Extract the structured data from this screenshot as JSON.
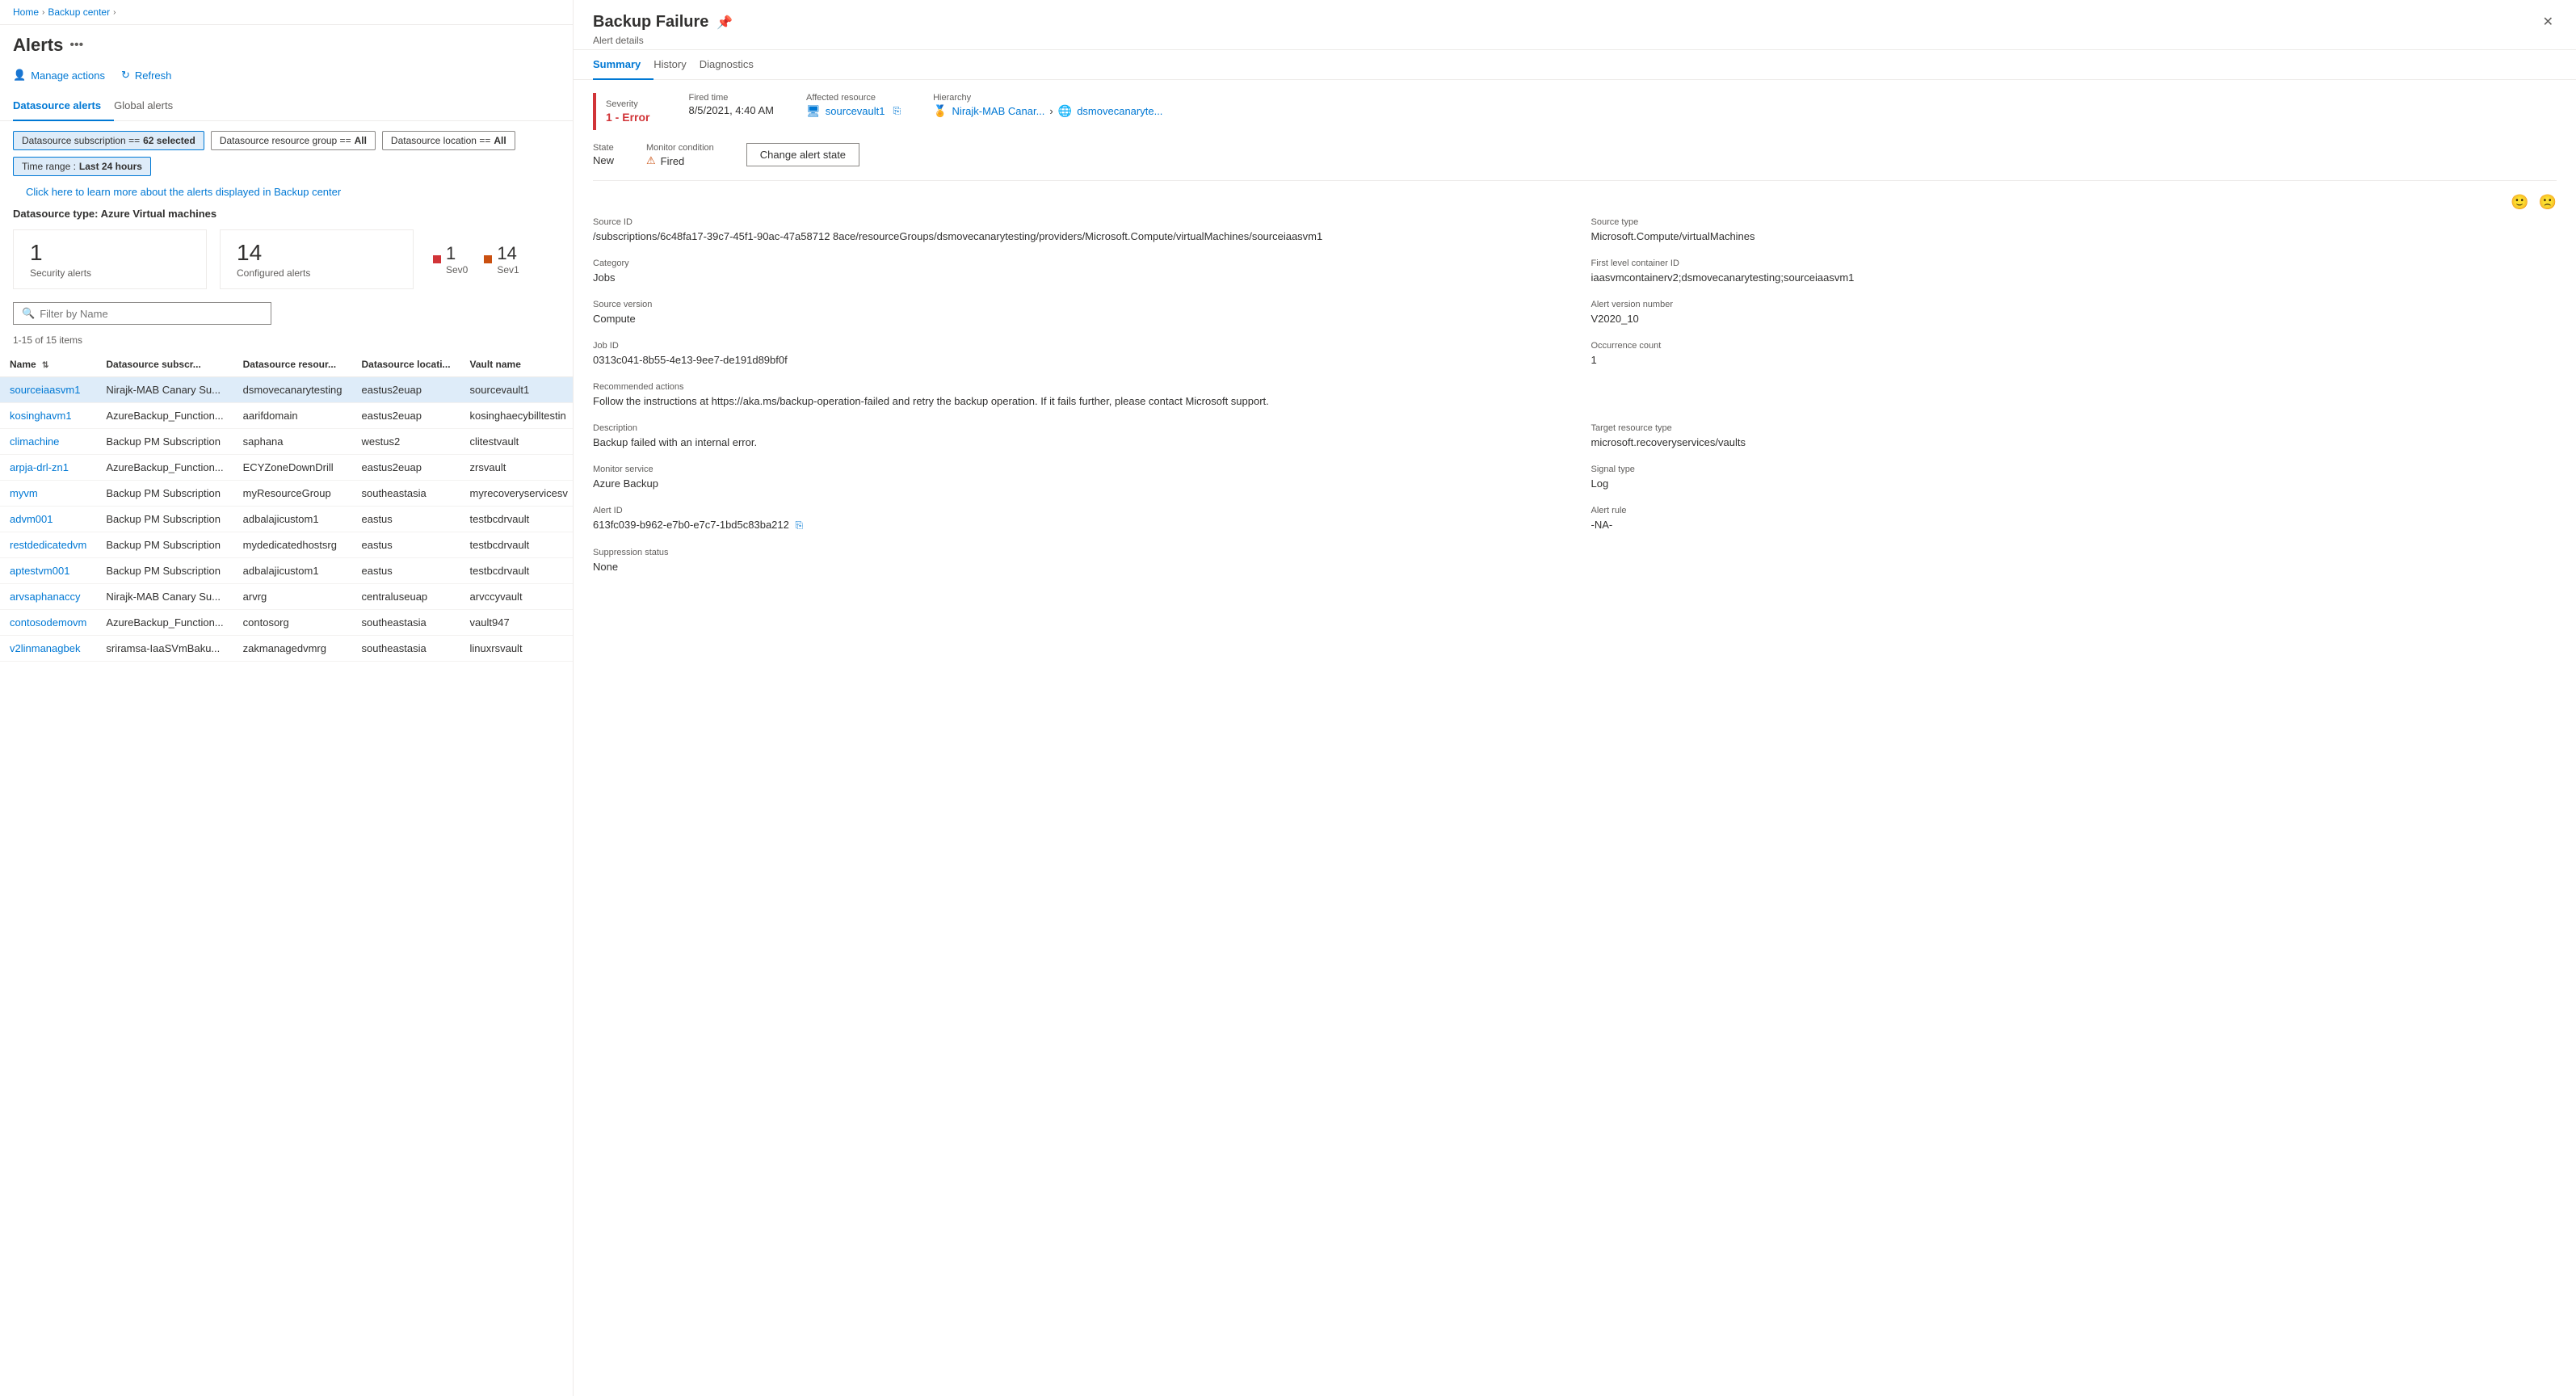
{
  "breadcrumb": {
    "home": "Home",
    "backup_center": "Backup center"
  },
  "page": {
    "title": "Alerts",
    "more_icon": "•••"
  },
  "toolbar": {
    "manage_actions_label": "Manage actions",
    "refresh_label": "Refresh"
  },
  "tabs": [
    {
      "id": "datasource",
      "label": "Datasource alerts",
      "active": true
    },
    {
      "id": "global",
      "label": "Global alerts",
      "active": false
    }
  ],
  "filters": [
    {
      "id": "subscription",
      "label": "Datasource subscription == ",
      "value": "62 selected",
      "active": true
    },
    {
      "id": "resource-group",
      "label": "Datasource resource group == ",
      "value": "All",
      "active": false
    },
    {
      "id": "location",
      "label": "Datasource location == ",
      "value": "All",
      "active": false
    },
    {
      "id": "time-range",
      "label": "Time range : ",
      "value": "Last 24 hours",
      "active": true
    }
  ],
  "info_link": "Click here to learn more about the alerts displayed in Backup center",
  "datasource_type_label": "Datasource type: Azure Virtual machines",
  "summary_cards": [
    {
      "id": "security",
      "number": "1",
      "label": "Security alerts"
    },
    {
      "id": "configured",
      "number": "14",
      "label": "Configured alerts"
    }
  ],
  "severity_badges": [
    {
      "id": "sev0",
      "count": "1",
      "label": "Sev0",
      "class": "sev0"
    },
    {
      "id": "sev1",
      "count": "14",
      "label": "Sev1",
      "class": "sev1"
    }
  ],
  "search": {
    "placeholder": "Filter by Name"
  },
  "items_count": "1-15 of 15 items",
  "table": {
    "columns": [
      {
        "id": "name",
        "label": "Name",
        "sortable": true
      },
      {
        "id": "subscription",
        "label": "Datasource subscr..."
      },
      {
        "id": "resource_group",
        "label": "Datasource resour..."
      },
      {
        "id": "location",
        "label": "Datasource locati..."
      },
      {
        "id": "vault",
        "label": "Vault name"
      }
    ],
    "rows": [
      {
        "name": "sourceiaasvm1",
        "subscription": "Nirajk-MAB Canary Su...",
        "resource_group": "dsmovecanarytesting",
        "location": "eastus2euap",
        "vault": "sourcevault1",
        "selected": true
      },
      {
        "name": "kosinghavm1",
        "subscription": "AzureBackup_Function...",
        "resource_group": "aarifdomain",
        "location": "eastus2euap",
        "vault": "kosinghaecybilltestin"
      },
      {
        "name": "climachine",
        "subscription": "Backup PM Subscription",
        "resource_group": "saphana",
        "location": "westus2",
        "vault": "clitestvault"
      },
      {
        "name": "arpja-drl-zn1",
        "subscription": "AzureBackup_Function...",
        "resource_group": "ECYZoneDownDrill",
        "location": "eastus2euap",
        "vault": "zrsvault"
      },
      {
        "name": "myvm",
        "subscription": "Backup PM Subscription",
        "resource_group": "myResourceGroup",
        "location": "southeastasia",
        "vault": "myrecoveryservicesv"
      },
      {
        "name": "advm001",
        "subscription": "Backup PM Subscription",
        "resource_group": "adbalajicustom1",
        "location": "eastus",
        "vault": "testbcdrvault"
      },
      {
        "name": "restdedicatedvm",
        "subscription": "Backup PM Subscription",
        "resource_group": "mydedicatedhostsrg",
        "location": "eastus",
        "vault": "testbcdrvault"
      },
      {
        "name": "aptestvm001",
        "subscription": "Backup PM Subscription",
        "resource_group": "adbalajicustom1",
        "location": "eastus",
        "vault": "testbcdrvault"
      },
      {
        "name": "arvsaphanaccy",
        "subscription": "Nirajk-MAB Canary Su...",
        "resource_group": "arvrg",
        "location": "centraluseuap",
        "vault": "arvccyvault"
      },
      {
        "name": "contosodemovm",
        "subscription": "AzureBackup_Function...",
        "resource_group": "contosorg",
        "location": "southeastasia",
        "vault": "vault947"
      },
      {
        "name": "v2linmanagbek",
        "subscription": "sriramsa-IaaSVmBaku...",
        "resource_group": "zakmanagedvmrg",
        "location": "southeastasia",
        "vault": "linuxrsvault"
      }
    ]
  },
  "right_panel": {
    "title": "Backup Failure",
    "subtitle": "Alert details",
    "tabs": [
      {
        "id": "summary",
        "label": "Summary",
        "active": true
      },
      {
        "id": "history",
        "label": "History"
      },
      {
        "id": "diagnostics",
        "label": "Diagnostics"
      }
    ],
    "severity": {
      "label": "Severity",
      "value": "1 - Error"
    },
    "fired_time": {
      "label": "Fired time",
      "value": "8/5/2021, 4:40 AM"
    },
    "affected_resource": {
      "label": "Affected resource",
      "value": "sourcevault1",
      "icon": "vm-icon"
    },
    "hierarchy": {
      "label": "Hierarchy",
      "item1": "Nirajk-MAB Canar...",
      "item2": "dsmovecanaryte..."
    },
    "state": {
      "label": "State",
      "value": "New"
    },
    "monitor_condition": {
      "label": "Monitor condition",
      "value": "Fired"
    },
    "change_state_btn": "Change alert state",
    "source_id": {
      "label": "Source ID",
      "value": "/subscriptions/6c48fa17-39c7-45f1-90ac-47a58712 8ace/resourceGroups/dsmovecanarytesting/providers/Microsoft.Compute/virtualMachines/sourceiaasvm1"
    },
    "source_type": {
      "label": "Source type",
      "value": "Microsoft.Compute/virtualMachines"
    },
    "category": {
      "label": "Category",
      "value": "Jobs"
    },
    "first_level_container": {
      "label": "First level container ID",
      "value": "iaasvmcontainerv2;dsmovecanarytesting;sourceiaasvm1"
    },
    "source_version": {
      "label": "Source version",
      "value": "Compute"
    },
    "alert_version": {
      "label": "Alert version number",
      "value": "V2020_10"
    },
    "job_id": {
      "label": "Job ID",
      "value": "0313c041-8b55-4e13-9ee7-de191d89bf0f"
    },
    "occurrence_count": {
      "label": "Occurrence count",
      "value": "1"
    },
    "recommended_actions": {
      "label": "Recommended actions",
      "value": "Follow the instructions at https://aka.ms/backup-operation-failed and retry the backup operation. If it fails further, please contact Microsoft support."
    },
    "description": {
      "label": "Description",
      "value": "Backup failed with an internal error."
    },
    "target_resource_type": {
      "label": "Target resource type",
      "value": "microsoft.recoveryservices/vaults"
    },
    "monitor_service": {
      "label": "Monitor service",
      "value": "Azure Backup"
    },
    "signal_type": {
      "label": "Signal type",
      "value": "Log"
    },
    "alert_id": {
      "label": "Alert ID",
      "value": "613fc039-b962-e7b0-e7c7-1bd5c83ba212"
    },
    "alert_rule": {
      "label": "Alert rule",
      "value": "-NA-"
    },
    "suppression_status": {
      "label": "Suppression status",
      "value": "None"
    }
  }
}
